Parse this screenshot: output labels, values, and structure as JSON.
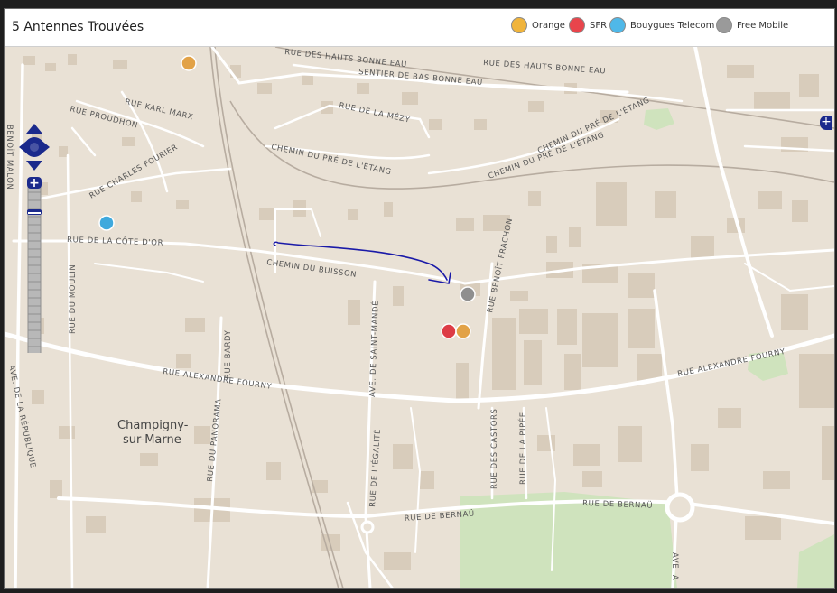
{
  "header": {
    "title": "5 Antennes Trouvées",
    "legend": [
      {
        "label": "Orange",
        "color": "#f0b43c"
      },
      {
        "label": "SFR",
        "color": "#e8454c"
      },
      {
        "label": "Bouygues Telecom",
        "color": "#4fb8e8"
      },
      {
        "label": "Free Mobile",
        "color": "#9a9a9a"
      }
    ]
  },
  "map": {
    "city_label_line1": "Champigny-",
    "city_label_line2": "sur-Marne",
    "streets": [
      "RUE DES HAUTS BONNE EAU",
      "RUE DES HAUTS BONNE EAU",
      "SENTIER DE BAS BONNE EAU",
      "RUE DE LA MÉZY",
      "RUE KARL MARX",
      "RUE PROUDHON",
      "RUE CHARLES FOURIER",
      "CHEMIN DU PRÉ DE L'ÉTANG",
      "CHEMIN DU PRÉ DE L'ÉTANG",
      "CHEMIN DU PRÉ DE L'ÉTANG",
      "RUE DE LA CÔTE D'OR",
      "CHEMIN DU BUISSON",
      "RUE BENOÎT FRACHON",
      "RUE DU MOULIN",
      "RUE BARDY",
      "AVE. DE SAINT-MANDÉ",
      "RUE ALEXANDRE FOURNY",
      "RUE ALEXANDRE FOURNY",
      "AVE. DE LA RÉPUBLIQUE",
      "RUE DU PANORAMA",
      "RUE DE L'ÉGALITÉ",
      "RUE DES CASTORS",
      "RUE DE LA PIPÉE",
      "RUE DE BERNAÜ",
      "RUE DE BERNAÜ",
      "AVE. A",
      "BENOÎT MALON"
    ],
    "antennas": [
      {
        "operator": "Orange",
        "color": "#e2a247"
      },
      {
        "operator": "Bouygues Telecom",
        "color": "#3fa9dd"
      },
      {
        "operator": "Free Mobile",
        "color": "#8f8f8f"
      },
      {
        "operator": "SFR",
        "color": "#dd3c46"
      },
      {
        "operator": "Orange",
        "color": "#e2a247"
      }
    ]
  },
  "controls": {
    "zoom_in": "+",
    "zoom_out": "−",
    "expand": "+"
  },
  "colors": {
    "control_blue": "#1b2a8c",
    "drawn_arrow": "#1a1aa8",
    "park": "#cfe3bd"
  }
}
